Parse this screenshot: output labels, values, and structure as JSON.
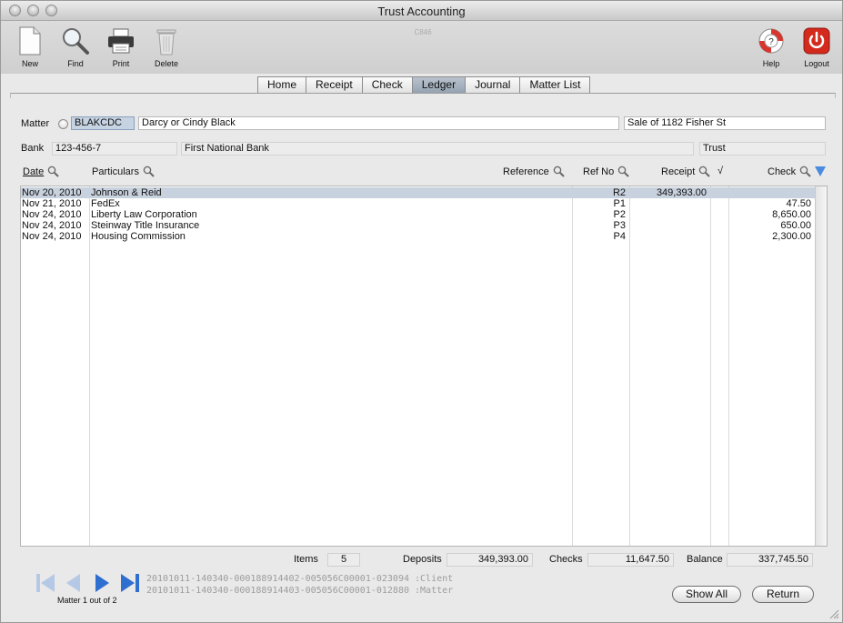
{
  "window": {
    "title": "Trust Accounting"
  },
  "toolbar": {
    "code": "C846",
    "new_label": "New",
    "find_label": "Find",
    "print_label": "Print",
    "delete_label": "Delete",
    "help_label": "Help",
    "logout_label": "Logout"
  },
  "tabs": [
    "Home",
    "Receipt",
    "Check",
    "Ledger",
    "Journal",
    "Matter List"
  ],
  "active_tab": "Ledger",
  "matter": {
    "label": "Matter",
    "code": "BLAKCDC",
    "client": "Darcy or Cindy Black",
    "description": "Sale of 1182 Fisher St"
  },
  "bank": {
    "label": "Bank",
    "account": "123-456-7",
    "name": "First National Bank",
    "type": "Trust"
  },
  "columns": {
    "date": "Date",
    "particulars": "Particulars",
    "reference": "Reference",
    "ref_no": "Ref No",
    "receipt": "Receipt",
    "check_mark": "√",
    "check": "Check"
  },
  "rows": [
    {
      "date": "Nov 20, 2010",
      "particulars": "Johnson & Reid",
      "ref_no": "R2",
      "receipt": "349,393.00",
      "check": ""
    },
    {
      "date": "Nov 21, 2010",
      "particulars": "FedEx",
      "ref_no": "P1",
      "receipt": "",
      "check": "47.50"
    },
    {
      "date": "Nov 24, 2010",
      "particulars": "Liberty Law Corporation",
      "ref_no": "P2",
      "receipt": "",
      "check": "8,650.00"
    },
    {
      "date": "Nov 24, 2010",
      "particulars": "Steinway Title Insurance",
      "ref_no": "P3",
      "receipt": "",
      "check": "650.00"
    },
    {
      "date": "Nov 24, 2010",
      "particulars": "Housing Commission",
      "ref_no": "P4",
      "receipt": "",
      "check": "2,300.00"
    }
  ],
  "totals": {
    "items_label": "Items",
    "items": "5",
    "deposits_label": "Deposits",
    "deposits": "349,393.00",
    "checks_label": "Checks",
    "checks": "11,647.50",
    "balance_label": "Balance",
    "balance": "337,745.50"
  },
  "footer": {
    "id_line_1": "20101011-140340-000188914402-005056C00001-023094 :Client",
    "id_line_2": "20101011-140340-000188914403-005056C00001-012880 :Matter",
    "matter_count": "Matter 1 out of 2",
    "show_all_label": "Show All",
    "return_label": "Return"
  },
  "colors": {
    "selected_row": "#c8d1de",
    "active_tab": "#a7b3c1",
    "nav_blue": "#2f6fd0",
    "logout_red": "#d42a1e"
  }
}
